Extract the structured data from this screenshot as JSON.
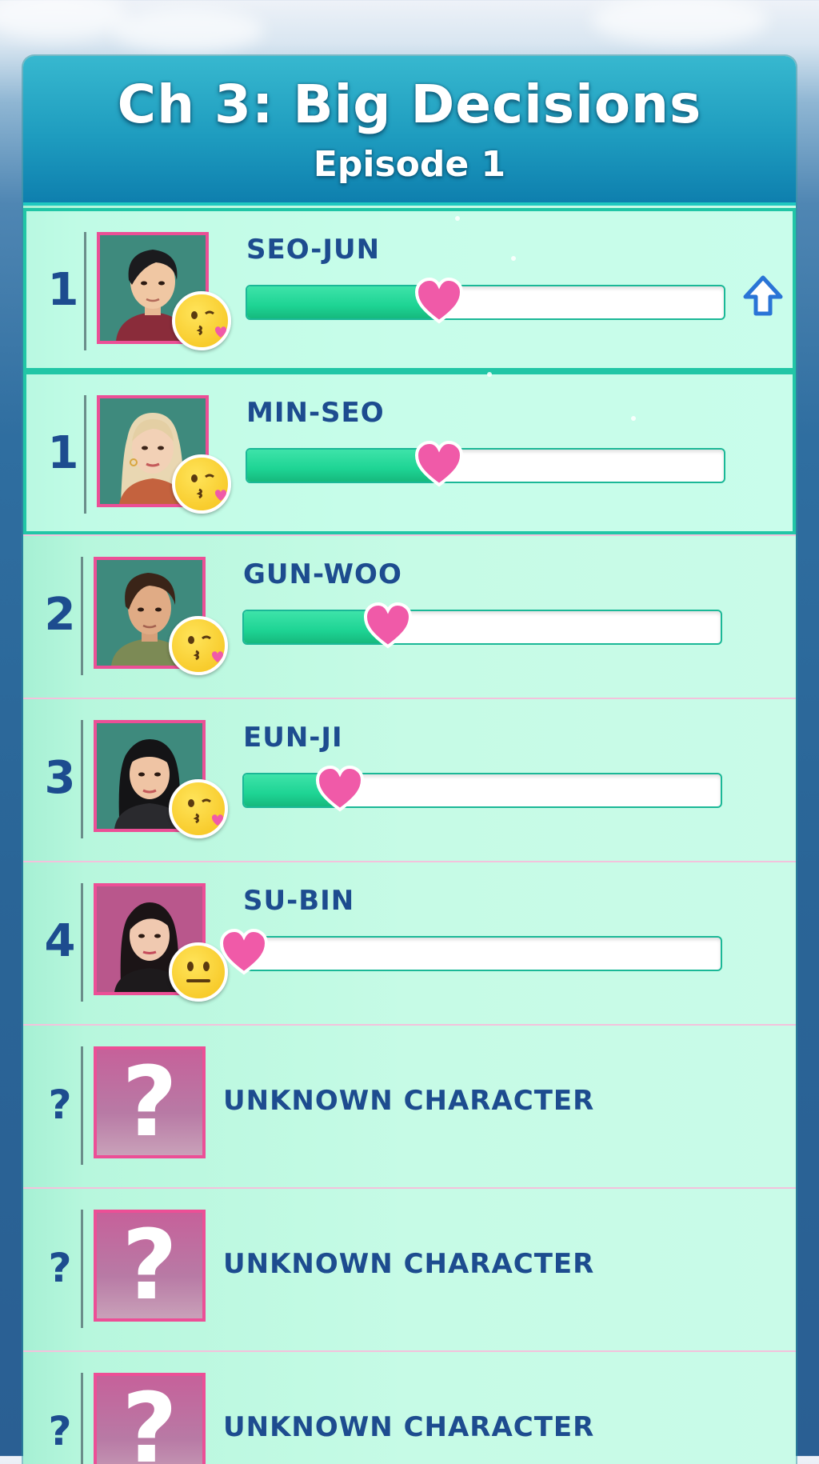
{
  "header": {
    "title": "Ch 3: Big Decisions",
    "subtitle": "Episode 1"
  },
  "characters": [
    {
      "rank": "1",
      "name": "SEO-JUN",
      "affection": 0.4,
      "mood": "kiss-face",
      "trend": "up",
      "highlight": true
    },
    {
      "rank": "1",
      "name": "MIN-SEO",
      "affection": 0.4,
      "mood": "kiss-face",
      "highlight": true
    },
    {
      "rank": "2",
      "name": "GUN-WOO",
      "affection": 0.3,
      "mood": "kiss-face"
    },
    {
      "rank": "3",
      "name": "EUN-JI",
      "affection": 0.2,
      "mood": "kiss-face"
    },
    {
      "rank": "4",
      "name": "SU-BIN",
      "affection": 0.0,
      "mood": "neutral-face"
    }
  ],
  "unknown": [
    {
      "rank": "?",
      "name": "UNKNOWN CHARACTER"
    },
    {
      "rank": "?",
      "name": "UNKNOWN CHARACTER"
    },
    {
      "rank": "?",
      "name": "UNKNOWN CHARACTER"
    }
  ],
  "colors": {
    "accent": "#1ed494",
    "heart": "#f05aa8",
    "text": "#1d4c8f",
    "frame": "#ec4f96"
  }
}
